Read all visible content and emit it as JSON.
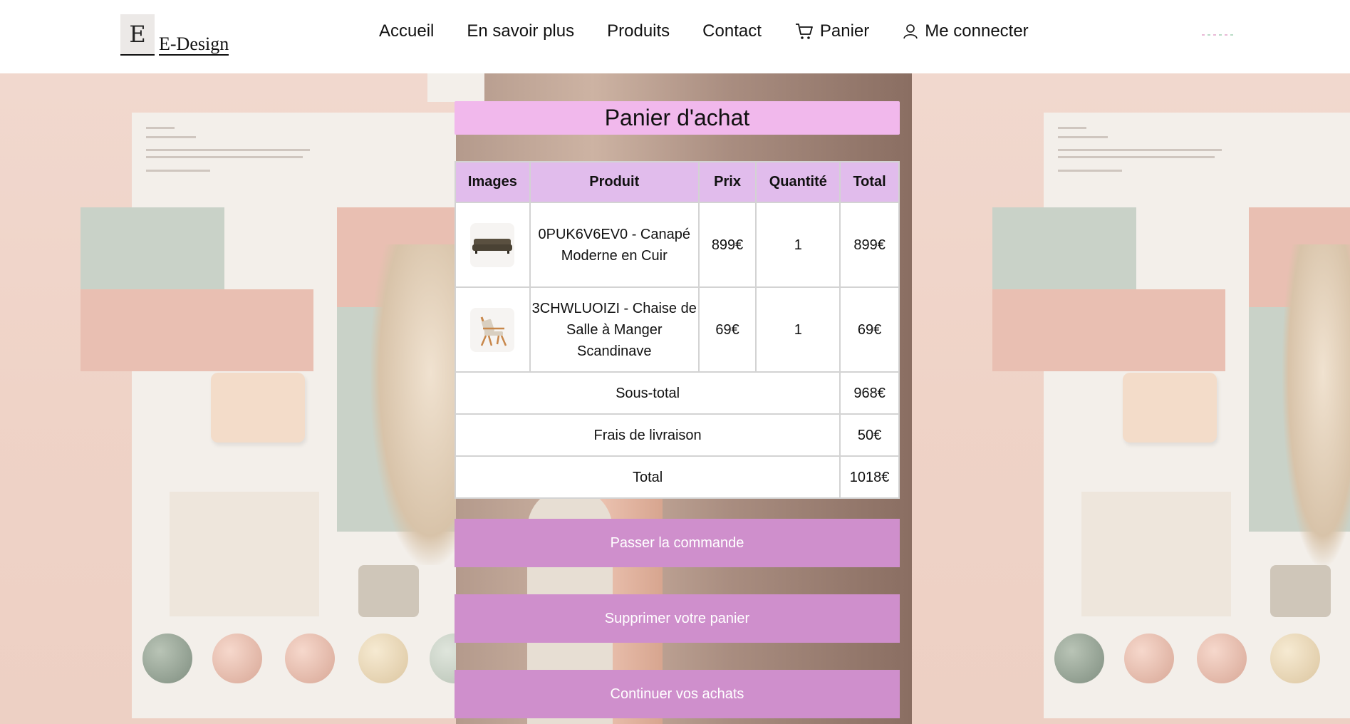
{
  "header": {
    "logo_letter": "E",
    "logo_text": "E-Design",
    "nav": {
      "home": "Accueil",
      "about": "En savoir plus",
      "products": "Produits",
      "contact": "Contact",
      "cart": "Panier",
      "login": "Me connecter"
    }
  },
  "cart": {
    "title": "Panier d'achat",
    "columns": {
      "images": "Images",
      "product": "Produit",
      "price": "Prix",
      "quantity": "Quantité",
      "total": "Total"
    },
    "items": [
      {
        "product": "0PUK6V6EV0 - Canapé Moderne en Cuir",
        "price": "899€",
        "quantity": "1",
        "total": "899€",
        "image_icon": "sofa-image"
      },
      {
        "product": "3CHWLUOIZI - Chaise de Salle à Manger Scandinave",
        "price": "69€",
        "quantity": "1",
        "total": "69€",
        "image_icon": "chair-image"
      }
    ],
    "summary": {
      "subtotal_label": "Sous-total",
      "subtotal_value": "968€",
      "shipping_label": "Frais de livraison",
      "shipping_value": "50€",
      "total_label": "Total",
      "total_value": "1018€"
    }
  },
  "actions": {
    "checkout": "Passer la commande",
    "clear": "Supprimer votre panier",
    "continue": "Continuer vos achats"
  },
  "colors": {
    "title_bg": "#f1b8ec",
    "table_header_bg": "#e1bcec",
    "button_bg": "#cf8fcc"
  }
}
